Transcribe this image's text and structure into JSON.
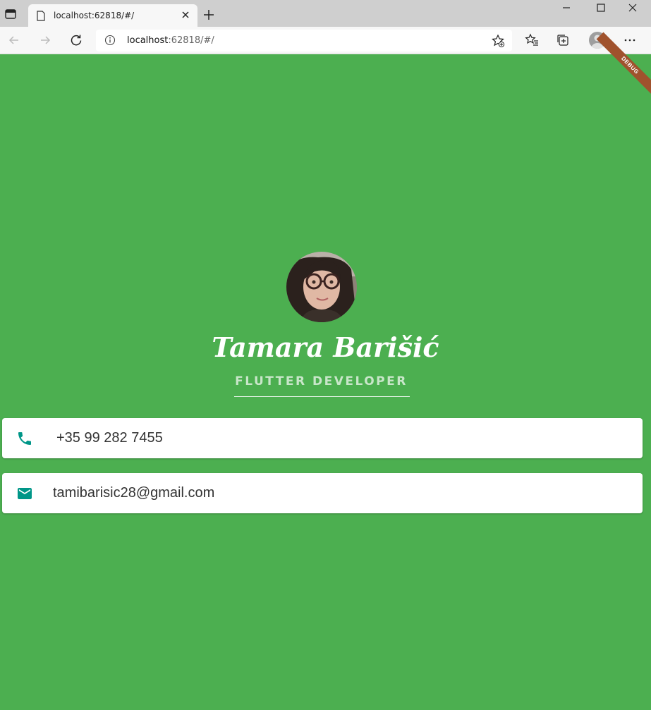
{
  "browser": {
    "tab_title": "localhost:62818/#/",
    "url_host": "localhost",
    "url_rest": ":62818/#/"
  },
  "app": {
    "debug_banner": "DEBUG",
    "name": "Tamara Barišić",
    "role": "FLUTTER DEVELOPER",
    "phone": "+35 99 282 7455",
    "email": "tamibarisic28@gmail.com",
    "colors": {
      "background": "#4caf50",
      "icon": "#009688",
      "role_text": "#c8e6c9"
    }
  }
}
